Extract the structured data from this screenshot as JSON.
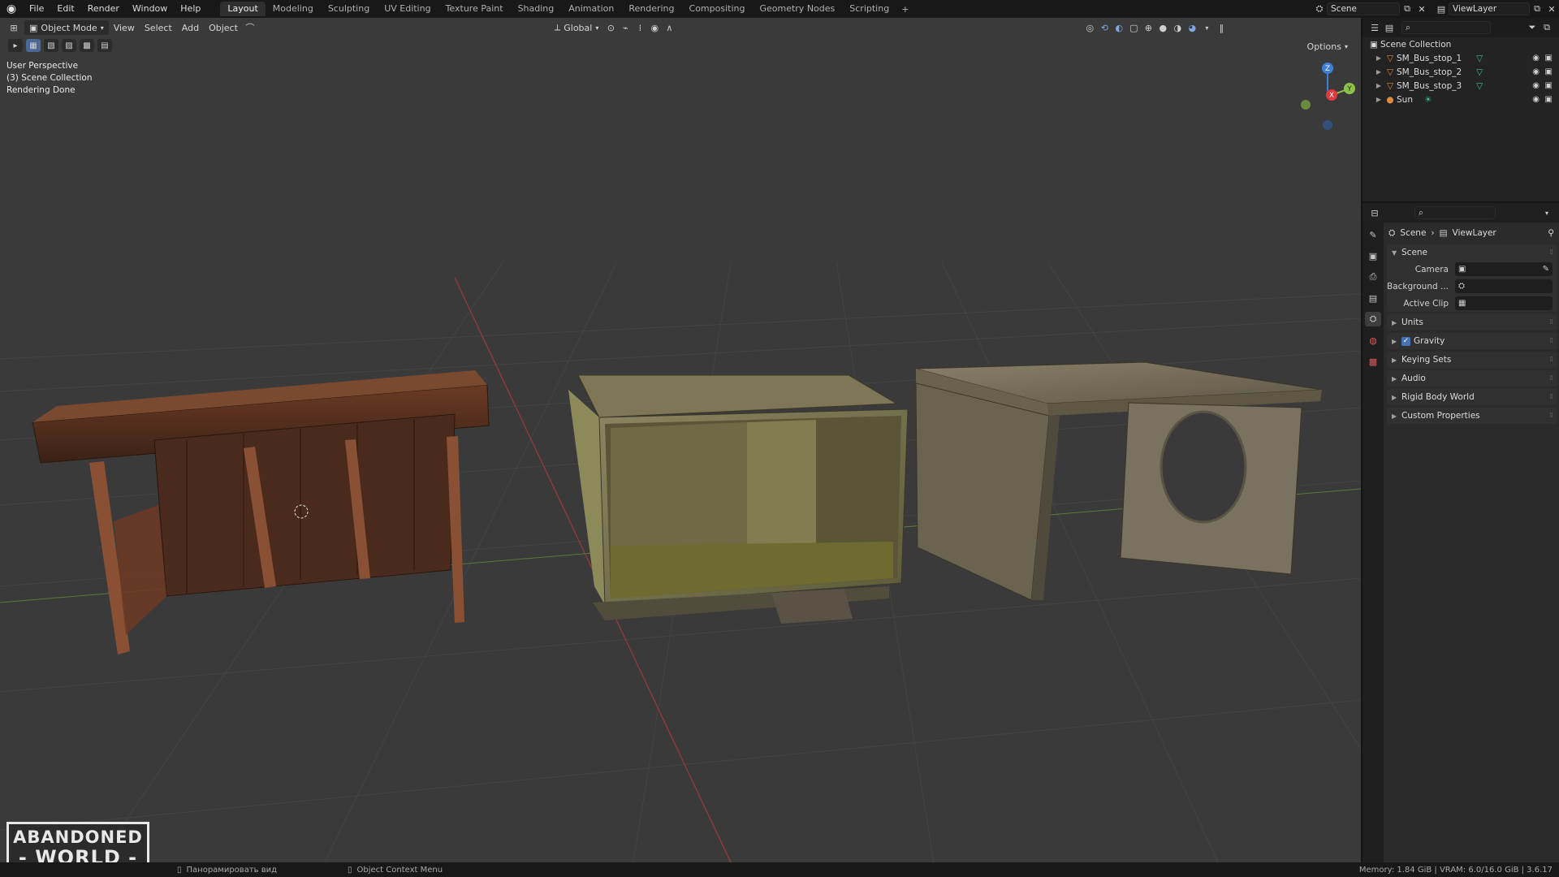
{
  "menubar": {
    "items": [
      "File",
      "Edit",
      "Render",
      "Window",
      "Help"
    ],
    "tabs": [
      "Layout",
      "Modeling",
      "Sculpting",
      "UV Editing",
      "Texture Paint",
      "Shading",
      "Animation",
      "Rendering",
      "Compositing",
      "Geometry Nodes",
      "Scripting"
    ],
    "active_tab": "Layout",
    "add_tab": "+",
    "scene_name": "Scene",
    "view_layer": "ViewLayer"
  },
  "viewport": {
    "mode": "Object Mode",
    "menus": [
      "View",
      "Select",
      "Add",
      "Object"
    ],
    "transform_orientation": "Global",
    "options_label": "Options",
    "overlay_lines": [
      "User Perspective",
      "(3) Scene Collection",
      "Rendering Done"
    ],
    "gizmo_axes": [
      "Z",
      "Y",
      "X"
    ]
  },
  "outliner": {
    "root": "Scene Collection",
    "items": [
      {
        "name": "SM_Bus_stop_1",
        "icon": "mesh-icon"
      },
      {
        "name": "SM_Bus_stop_2",
        "icon": "mesh-icon"
      },
      {
        "name": "SM_Bus_stop_3",
        "icon": "mesh-icon"
      },
      {
        "name": "Sun",
        "icon": "light-icon"
      }
    ]
  },
  "properties": {
    "breadcrumb": [
      "Scene",
      "ViewLayer"
    ],
    "scene_panel": "Scene",
    "fields": [
      {
        "label": "Camera",
        "value": ""
      },
      {
        "label": "Background ...",
        "value": ""
      },
      {
        "label": "Active Clip",
        "value": ""
      }
    ],
    "subpanels": [
      "Units",
      "Gravity",
      "Keying Sets",
      "Audio",
      "Rigid Body World",
      "Custom Properties"
    ],
    "gravity_checked": true
  },
  "statusbar": {
    "hint_pan": "Панорамировать вид",
    "hint_context": "Object Context Menu",
    "memory": "Memory: 1.84 GiB | VRAM: 6.0/16.0 GiB | 3.6.17"
  },
  "watermark": {
    "line1": "ABANDONED",
    "line2": "- WORLD -"
  },
  "colors": {
    "accent": "#4772b3",
    "axis_x": "#e0393e",
    "axis_y": "#8bc34a",
    "axis_z": "#3d7fd6"
  }
}
